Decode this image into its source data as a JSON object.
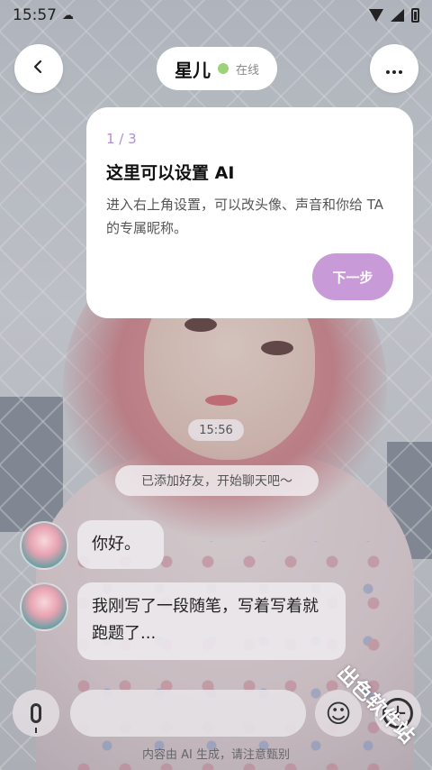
{
  "status_bar": {
    "time": "15:57"
  },
  "header": {
    "back_icon": "chevron-left-icon",
    "name": "星儿",
    "status": "在线",
    "more_icon": "more-horizontal-icon"
  },
  "guide": {
    "step": "1 / 3",
    "title": "这里可以设置 AI",
    "description": "进入右上角设置，可以改头像、声音和你给 TA 的专属昵称。",
    "next_label": "下一步"
  },
  "chat": {
    "timestamp": "15:56",
    "system_message": "已添加好友，开始聊天吧～",
    "messages": [
      {
        "sender": "ai",
        "text": "你好。"
      },
      {
        "sender": "ai",
        "text": "我刚写了一段随笔，写着写着就跑题了..."
      }
    ]
  },
  "composer": {
    "mic_icon": "microphone-icon",
    "emoji_icon": "smile-icon",
    "plus_icon": "plus-circle-icon"
  },
  "footer": {
    "notice": "内容由 AI 生成，请注意甄别"
  },
  "watermark": "出色软件站",
  "colors": {
    "accent": "#c89bd8",
    "online": "#9bd27a"
  }
}
